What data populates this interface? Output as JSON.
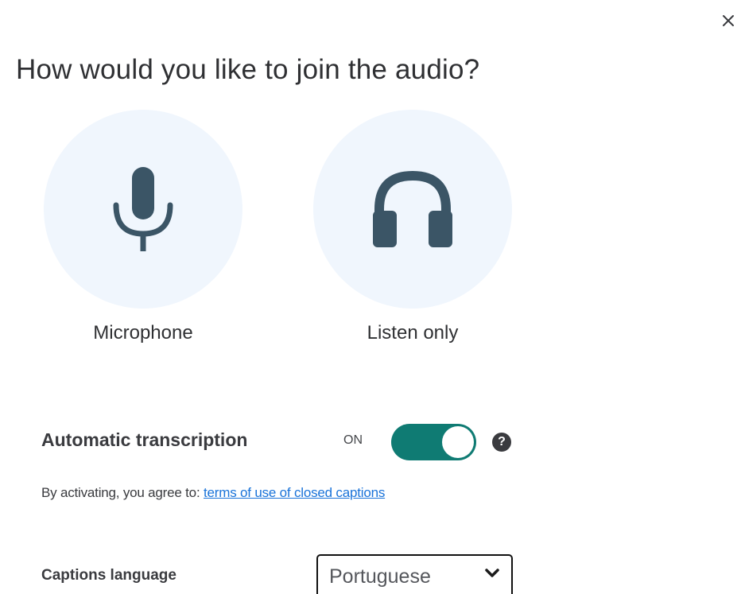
{
  "dialog": {
    "title": "How would you like to join the audio?",
    "close_icon": "close-icon"
  },
  "options": {
    "microphone": {
      "label": "Microphone",
      "icon": "microphone-icon"
    },
    "listen_only": {
      "label": "Listen only",
      "icon": "headphones-icon"
    }
  },
  "transcription": {
    "label": "Automatic transcription",
    "state_label": "ON",
    "enabled": true,
    "help_icon": "?",
    "agree_text": "By activating, you agree to: ",
    "terms_link": "terms of use of closed captions"
  },
  "captions": {
    "label": "Captions language",
    "selected": "Portuguese"
  },
  "colors": {
    "accent_toggle": "#0f7b73",
    "option_bg": "#f0f6fd",
    "icon_color": "#3b5566",
    "link": "#1a73d9"
  }
}
